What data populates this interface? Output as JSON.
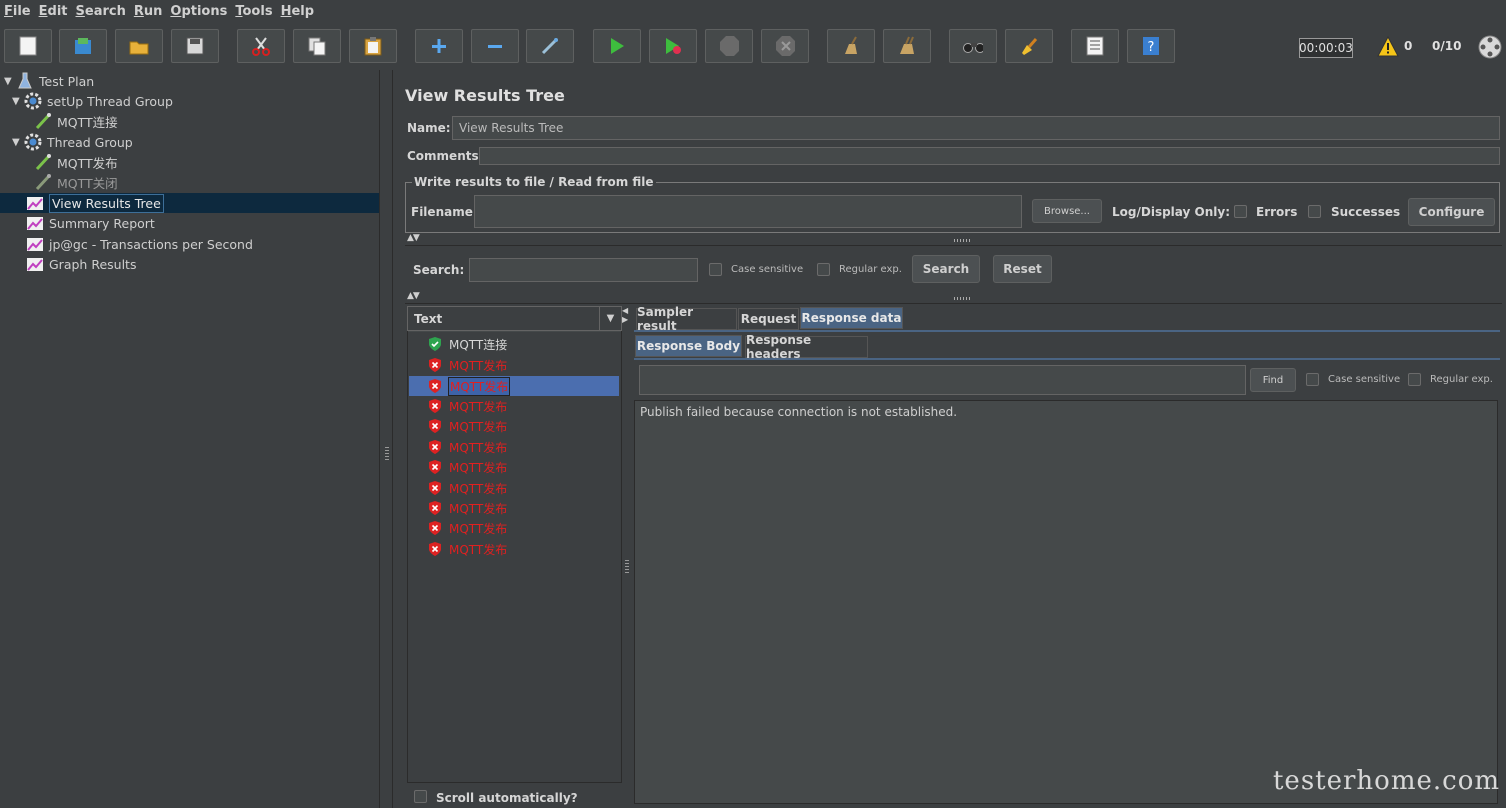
{
  "menu": [
    {
      "label": "File",
      "mnemonic": "F",
      "rest": "ile"
    },
    {
      "label": "Edit",
      "mnemonic": "E",
      "rest": "dit"
    },
    {
      "label": "Search",
      "mnemonic": "S",
      "rest": "earch"
    },
    {
      "label": "Run",
      "mnemonic": "R",
      "rest": "un"
    },
    {
      "label": "Options",
      "mnemonic": "O",
      "rest": "ptions"
    },
    {
      "label": "Tools",
      "mnemonic": "T",
      "rest": "ools"
    },
    {
      "label": "Help",
      "mnemonic": "H",
      "rest": "elp"
    }
  ],
  "toolbar": {
    "timer": "00:00:03",
    "warning_count": "0",
    "threads": "0/10"
  },
  "tree": {
    "items": [
      {
        "label": "Test Plan"
      },
      {
        "label": "setUp Thread Group"
      },
      {
        "label": "MQTT连接"
      },
      {
        "label": "Thread Group"
      },
      {
        "label": "MQTT发布"
      },
      {
        "label": "MQTT关闭"
      },
      {
        "label": "View Results Tree"
      },
      {
        "label": "Summary Report"
      },
      {
        "label": "jp@gc - Transactions per Second"
      },
      {
        "label": "Graph Results"
      }
    ]
  },
  "panel": {
    "title": "View Results Tree",
    "name_label": "Name:",
    "name_value": "View Results Tree",
    "comments_label": "Comments:",
    "write_legend": "Write results to file / Read from file",
    "filename_label": "Filename",
    "browse_label": "Browse...",
    "log_display_label": "Log/Display Only:",
    "errors_label": "Errors",
    "successes_label": "Successes",
    "configure_label": "Configure",
    "search_label": "Search:",
    "case_sensitive": "Case sensitive",
    "regular_exp": "Regular exp.",
    "search_button": "Search",
    "reset_button": "Reset"
  },
  "results": {
    "renderer": "Text",
    "items": [
      {
        "label": "MQTT连接",
        "status": "ok"
      },
      {
        "label": "MQTT发布",
        "status": "err"
      },
      {
        "label": "MQTT发布",
        "status": "err"
      },
      {
        "label": "MQTT发布",
        "status": "err"
      },
      {
        "label": "MQTT发布",
        "status": "err"
      },
      {
        "label": "MQTT发布",
        "status": "err"
      },
      {
        "label": "MQTT发布",
        "status": "err"
      },
      {
        "label": "MQTT发布",
        "status": "err"
      },
      {
        "label": "MQTT发布",
        "status": "err"
      },
      {
        "label": "MQTT发布",
        "status": "err"
      },
      {
        "label": "MQTT发布",
        "status": "err"
      }
    ],
    "scroll_auto": "Scroll automatically?"
  },
  "tabs": {
    "sampler": "Sampler result",
    "request": "Request",
    "response": "Response data",
    "body": "Response Body",
    "headers": "Response headers",
    "find": "Find",
    "case_sensitive": "Case sensitive",
    "regular_exp": "Regular exp."
  },
  "response_text": "Publish failed because connection is not established.",
  "watermark": "testerhome.com"
}
